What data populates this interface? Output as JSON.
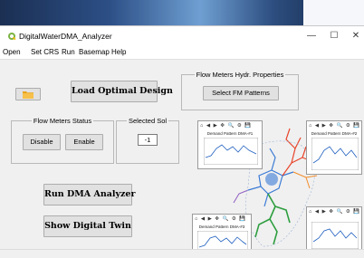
{
  "window": {
    "title": "DigitalWaterDMA_Analyzer",
    "minimize_glyph": "—",
    "maximize_glyph": "☐",
    "close_glyph": "✕"
  },
  "menu": [
    "Open",
    "Set CRS",
    "Run",
    "Basemap",
    "Help"
  ],
  "actions": {
    "folder_icon": "folder-icon",
    "load_optimal_design": "Load Optimal Design",
    "run_dma_analyzer": "Run DMA Analyzer",
    "show_digital_twin": "Show Digital Twin"
  },
  "fm_hydr": {
    "group_title": "Flow Meters Hydr. Properties",
    "select_button": "Select FM Patterns"
  },
  "fm_status": {
    "group_title": "Flow Meters Status",
    "disable_button": "Disable",
    "enable_button": "Enable"
  },
  "selected_sol": {
    "label": "Selected Sol",
    "value": "-1"
  },
  "visualization": {
    "plot_titles": [
      "Demand Pattern DMA-#1",
      "Demand Pattern DMA-#2",
      "Demand Pattern DMA-#3"
    ],
    "toolbar_glyphs": "⌂ ◀ ▶ ✥ 🔍 ⚙ 💾",
    "network_colors": [
      "#3a7bd5",
      "#e8442a",
      "#2e9e3f",
      "#f28c28",
      "#8f5cc2"
    ]
  }
}
